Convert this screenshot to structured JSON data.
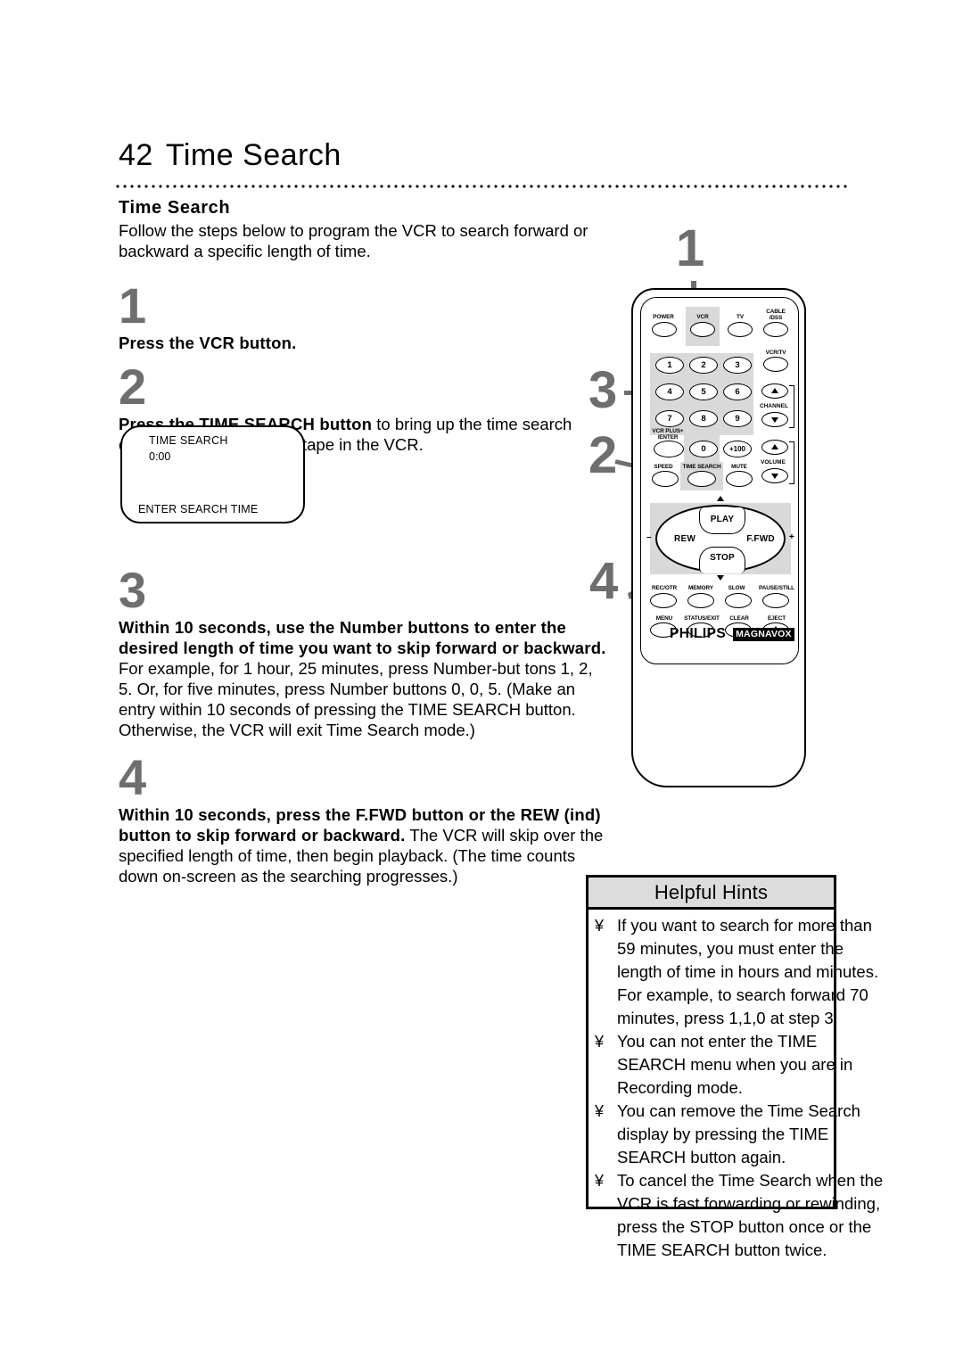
{
  "page": {
    "number": "42",
    "title": "Time Search"
  },
  "section": {
    "heading": "Time Search",
    "intro": "Follow the steps below to program the VCR to search forward or backward a specific length of time."
  },
  "steps": [
    {
      "number": "1",
      "bold": "Press the VCR button.",
      "rest": ""
    },
    {
      "number": "2",
      "bold": "Press the TIME SEARCH button",
      "rest": " to bring up the time search display. There must be a tape in the VCR."
    },
    {
      "number": "3",
      "bold": "Within 10 seconds, use the Number buttons to enter the desired length of time you want to skip forward or backward.",
      "rest": " For example, for 1 hour, 25 minutes, press Number-but tons 1, 2, 5. Or, for five minutes, press Number buttons 0, 0, 5. (Make an entry within 10 seconds of pressing the TIME SEARCH button. Otherwise, the VCR will exit Time Search mode.)"
    },
    {
      "number": "4",
      "bold": "Within 10 seconds, press the F.FWD button or the REW (ind) button to skip forward or backward.",
      "rest": " The VCR will skip over the specified length of time, then begin playback. (The time counts down on-screen as the searching progresses.)"
    }
  ],
  "osd": {
    "title": "TIME SEARCH",
    "time": "0:00",
    "footer": "ENTER SEARCH TIME"
  },
  "callouts": {
    "one": "1",
    "two": "2",
    "three": "3",
    "four": "4"
  },
  "remote": {
    "top_row": [
      "POWER",
      "VCR",
      "TV",
      "CABLE\n/DSS"
    ],
    "numbers": [
      "1",
      "2",
      "3",
      "4",
      "5",
      "6",
      "7",
      "8",
      "9"
    ],
    "vcr_plus": "VCR PLUS+\n/ENTER",
    "zero": "0",
    "plus100": "+100",
    "speed": "SPEED",
    "time_search": "TIME SEARCH",
    "mute": "MUTE",
    "vcrtv": "VCR/TV",
    "channel": "CHANNEL",
    "volume": "VOLUME",
    "transport": {
      "play": "PLAY",
      "stop": "STOP",
      "rew": "REW",
      "ffwd": "F.FWD",
      "minus": "–",
      "plus": "+"
    },
    "bottom_rows": [
      [
        "REC/OTR",
        "MEMORY",
        "SLOW",
        "PAUSE/STILL"
      ],
      [
        "MENU",
        "STATUS/EXIT",
        "CLEAR",
        "EJECT"
      ]
    ],
    "brand_primary": "PHILIPS",
    "brand_secondary": "MAGNAVOX"
  },
  "hints": {
    "title": "Helpful Hints",
    "bullet_glyph": "¥",
    "items": [
      "If you want to search for more than\n59 minutes, you must enter the\nlength of time in hours and minutes.\nFor example, to search forward 70\nminutes, press 1,1,0 at step 3.",
      "You can not enter the TIME\nSEARCH menu when you are in\nRecording mode.",
      "You can remove the Time Search\ndisplay by pressing the TIME\nSEARCH button again.",
      "To cancel the Time Search when the\nVCR is fast forwarding or rewinding,\npress the STOP button once or the\nTIME SEARCH button twice."
    ]
  },
  "colors": {
    "step_number": "#6e6e6e",
    "highlight": "#d9d9d9",
    "hints_header": "#dcdcdc"
  }
}
